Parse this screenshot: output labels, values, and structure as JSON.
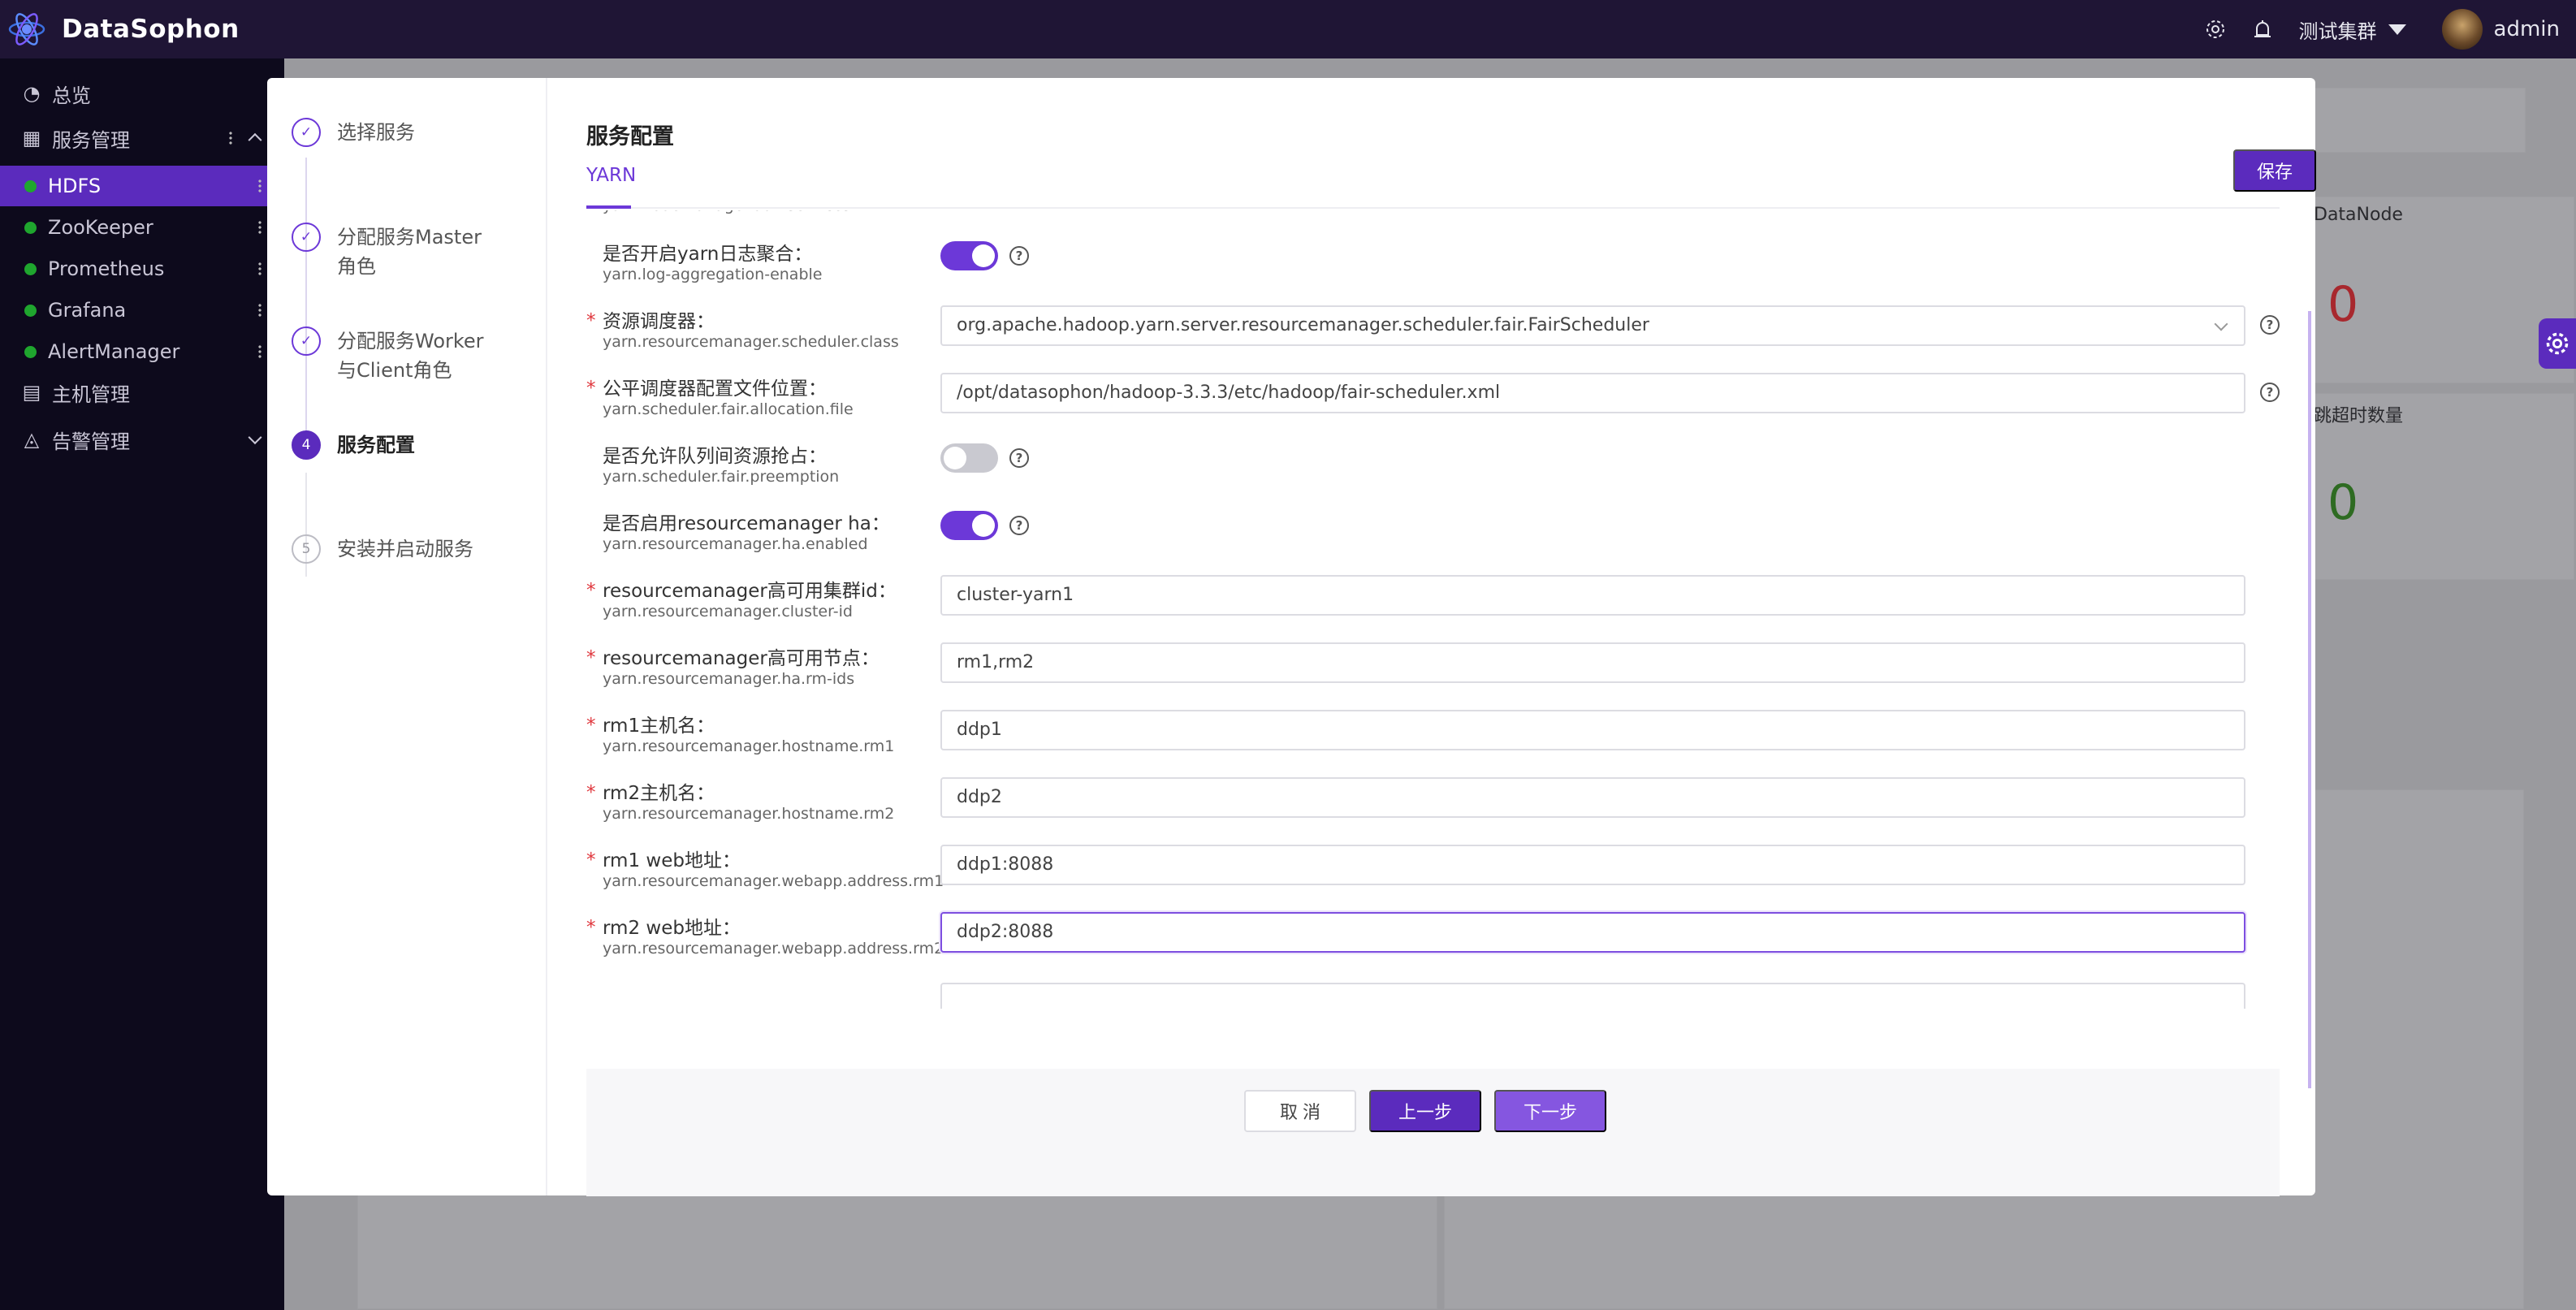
{
  "app": {
    "title": "DataSophon",
    "cluster": "测试集群",
    "user": "admin"
  },
  "sidebar": {
    "items": [
      {
        "label": "总览",
        "icon": "dashboard-icon"
      },
      {
        "label": "服务管理",
        "icon": "grid-icon"
      },
      {
        "label": "HDFS",
        "status": "running"
      },
      {
        "label": "ZooKeeper",
        "status": "running"
      },
      {
        "label": "Prometheus",
        "status": "running"
      },
      {
        "label": "Grafana",
        "status": "running"
      },
      {
        "label": "AlertManager",
        "status": "running"
      },
      {
        "label": "主机管理",
        "icon": "server-icon"
      },
      {
        "label": "告警管理",
        "icon": "bell-icon"
      }
    ]
  },
  "background": {
    "card1_label": "DataNode",
    "card1_value": "0",
    "card2_label": "跳超时数量",
    "card2_value": "0"
  },
  "steps": [
    {
      "num": "1",
      "label": "选择服务",
      "state": "done"
    },
    {
      "num": "2",
      "label": "分配服务Master角色",
      "state": "done"
    },
    {
      "num": "3",
      "label": "分配服务Worker与Client角色",
      "state": "done"
    },
    {
      "num": "4",
      "label": "服务配置",
      "state": "active"
    },
    {
      "num": "5",
      "label": "安装并启动服务",
      "state": "pending"
    }
  ],
  "config": {
    "title": "服务配置",
    "tab": "YARN",
    "save_label": "保存",
    "rows": [
      {
        "label": "",
        "key": "yarn.nodemanager.aux-services",
        "type": "input",
        "value": "",
        "required": false,
        "help": false
      },
      {
        "label": "是否开启yarn日志聚合：",
        "key": "yarn.log-aggregation-enable",
        "type": "toggle",
        "on": true,
        "required": false,
        "help": true
      },
      {
        "label": "资源调度器：",
        "key": "yarn.resourcemanager.scheduler.class",
        "type": "select",
        "value": "org.apache.hadoop.yarn.server.resourcemanager.scheduler.fair.FairScheduler",
        "required": true,
        "help": true
      },
      {
        "label": "公平调度器配置文件位置：",
        "key": "yarn.scheduler.fair.allocation.file",
        "type": "input",
        "value": "/opt/datasophon/hadoop-3.3.3/etc/hadoop/fair-scheduler.xml",
        "required": true,
        "help": true
      },
      {
        "label": "是否允许队列间资源抢占：",
        "key": "yarn.scheduler.fair.preemption",
        "type": "toggle",
        "on": false,
        "required": false,
        "help": true
      },
      {
        "label": "是否启用resourcemanager ha：",
        "key": "yarn.resourcemanager.ha.enabled",
        "type": "toggle",
        "on": true,
        "required": false,
        "help": true
      },
      {
        "label": "resourcemanager高可用集群id：",
        "key": "yarn.resourcemanager.cluster-id",
        "type": "input",
        "value": "cluster-yarn1",
        "required": true,
        "help": false
      },
      {
        "label": "resourcemanager高可用节点：",
        "key": "yarn.resourcemanager.ha.rm-ids",
        "type": "input",
        "value": "rm1,rm2",
        "required": true,
        "help": false
      },
      {
        "label": "rm1主机名：",
        "key": "yarn.resourcemanager.hostname.rm1",
        "type": "input",
        "value": "ddp1",
        "required": true,
        "help": false
      },
      {
        "label": "rm2主机名：",
        "key": "yarn.resourcemanager.hostname.rm2",
        "type": "input",
        "value": "ddp2",
        "required": true,
        "help": false
      },
      {
        "label": "rm1 web地址：",
        "key": "yarn.resourcemanager.webapp.address.rm1",
        "type": "input",
        "value": "ddp1:8088",
        "required": true,
        "help": false
      },
      {
        "label": "rm2 web地址：",
        "key": "yarn.resourcemanager.webapp.address.rm2",
        "type": "input",
        "value": "ddp2:8088",
        "required": true,
        "help": false,
        "focused": true
      }
    ]
  },
  "footer": {
    "cancel": "取 消",
    "prev": "上一步",
    "next": "下一步"
  },
  "colors": {
    "primary": "#5b2bbd",
    "header": "#1f1535",
    "sidebar": "#0d0a1c",
    "status_ok": "#1fa62e",
    "required": "#e0383e"
  }
}
